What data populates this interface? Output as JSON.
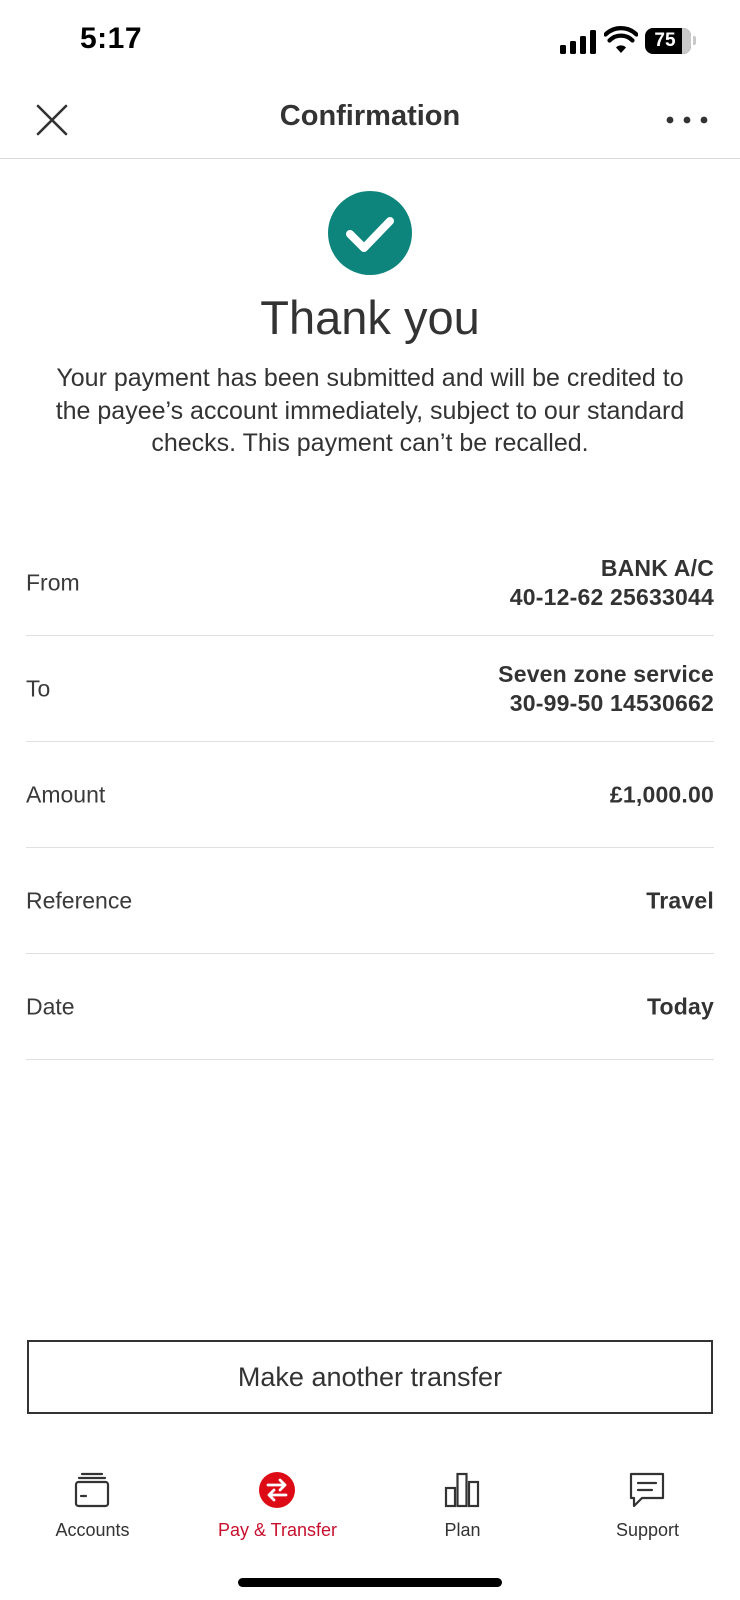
{
  "status_bar": {
    "time": "5:17",
    "battery": "75"
  },
  "header": {
    "title": "Confirmation",
    "close_icon": "close-icon",
    "more_icon": "more-horizontal-icon"
  },
  "success": {
    "icon": "checkmark-circle-icon",
    "icon_color": "#0e857c",
    "heading": "Thank you",
    "message": "Your payment has been submitted and will be credited to the payee’s account immediately, subject to our standard checks. This payment can’t be recalled."
  },
  "details": {
    "from": {
      "label": "From",
      "line1": "BANK A/C",
      "line2": "40-12-62 25633044"
    },
    "to": {
      "label": "To",
      "line1": "Seven zone service",
      "line2": "30-99-50 14530662"
    },
    "amount": {
      "label": "Amount",
      "value": "£1,000.00"
    },
    "reference": {
      "label": "Reference",
      "value": "Travel"
    },
    "date": {
      "label": "Date",
      "value": "Today"
    }
  },
  "actions": {
    "make_another_transfer": "Make another transfer"
  },
  "tab_bar": {
    "accent_color": "#c8102e",
    "tabs": [
      {
        "label": "Accounts",
        "icon": "accounts-wallet-icon",
        "active": false
      },
      {
        "label": "Pay & Transfer",
        "icon": "transfer-arrows-icon",
        "active": true
      },
      {
        "label": "Plan",
        "icon": "bar-chart-icon",
        "active": false
      },
      {
        "label": "Support",
        "icon": "chat-bubble-icon",
        "active": false
      }
    ]
  }
}
